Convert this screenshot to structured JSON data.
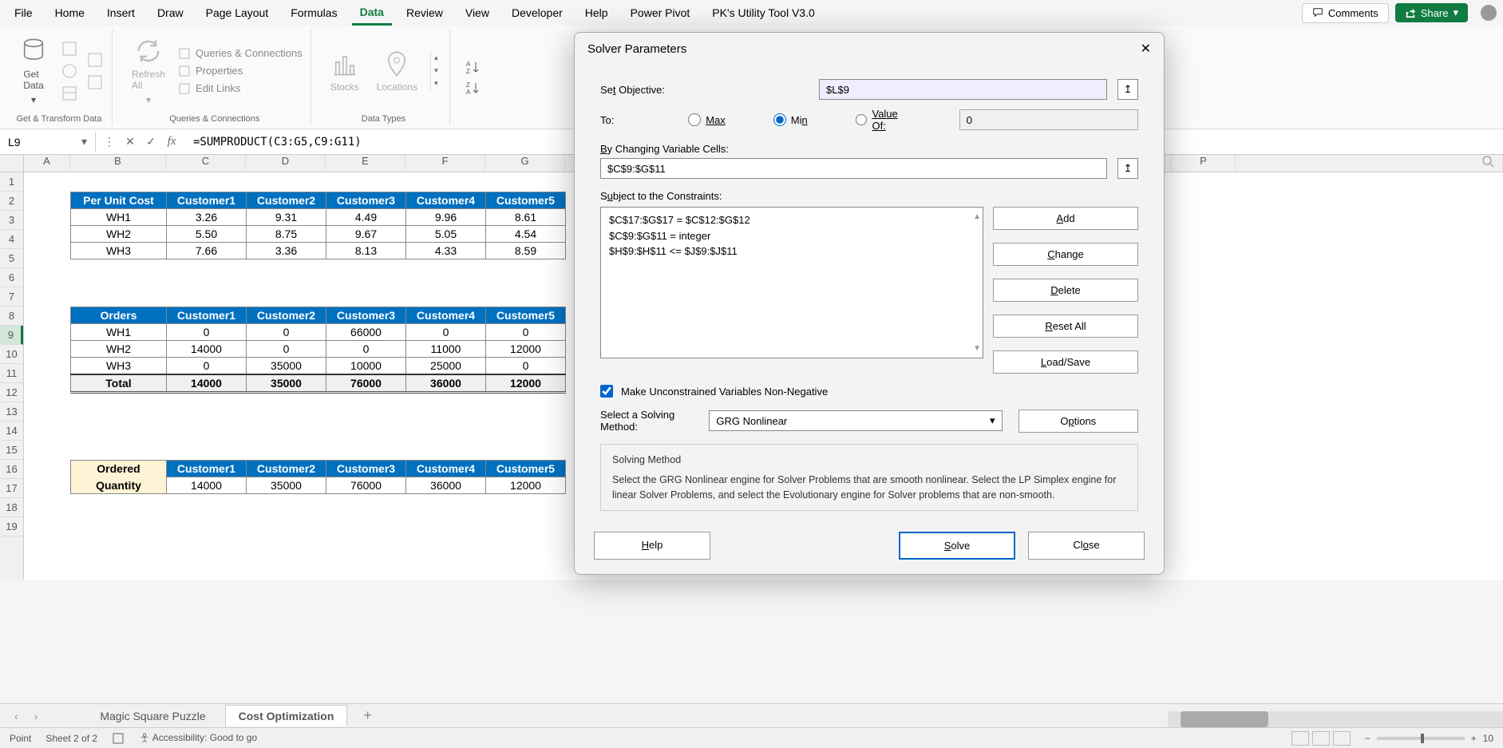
{
  "menu": {
    "items": [
      "File",
      "Home",
      "Insert",
      "Draw",
      "Page Layout",
      "Formulas",
      "Data",
      "Review",
      "View",
      "Developer",
      "Help",
      "Power Pivot",
      "PK's Utility Tool V3.0"
    ],
    "active": "Data",
    "comments": "Comments",
    "share": "Share"
  },
  "ribbon": {
    "group1": {
      "get_data": "Get\nData",
      "label": "Get & Transform Data"
    },
    "group2": {
      "refresh": "Refresh\nAll",
      "queries": "Queries & Connections",
      "properties": "Properties",
      "edit_links": "Edit Links",
      "label": "Queries & Connections"
    },
    "group3": {
      "stocks": "Stocks",
      "locations": "Locations",
      "label": "Data Types"
    }
  },
  "formula_bar": {
    "name": "L9",
    "formula": "=SUMPRODUCT(C3:G5,C9:G11)"
  },
  "columns": [
    "A",
    "B",
    "C",
    "D",
    "E",
    "F",
    "G",
    "P"
  ],
  "rows": [
    "1",
    "2",
    "3",
    "4",
    "5",
    "6",
    "7",
    "8",
    "9",
    "10",
    "11",
    "12",
    "13",
    "14",
    "15",
    "16",
    "17",
    "18",
    "19"
  ],
  "selected_row": "9",
  "tbl1": {
    "headers": [
      "Per Unit Cost",
      "Customer1",
      "Customer2",
      "Customer3",
      "Customer4",
      "Customer5"
    ],
    "rows": [
      [
        "WH1",
        "3.26",
        "9.31",
        "4.49",
        "9.96",
        "8.61"
      ],
      [
        "WH2",
        "5.50",
        "8.75",
        "9.67",
        "5.05",
        "4.54"
      ],
      [
        "WH3",
        "7.66",
        "3.36",
        "8.13",
        "4.33",
        "8.59"
      ]
    ]
  },
  "tbl2": {
    "headers": [
      "Orders",
      "Customer1",
      "Customer2",
      "Customer3",
      "Customer4",
      "Customer5"
    ],
    "rows": [
      [
        "WH1",
        "0",
        "0",
        "66000",
        "0",
        "0"
      ],
      [
        "WH2",
        "14000",
        "0",
        "0",
        "11000",
        "12000"
      ],
      [
        "WH3",
        "0",
        "35000",
        "10000",
        "25000",
        "0"
      ]
    ],
    "total": [
      "Total",
      "14000",
      "35000",
      "76000",
      "36000",
      "12000"
    ]
  },
  "tbl3": {
    "headers": [
      "Ordered",
      "Customer1",
      "Customer2",
      "Customer3",
      "Customer4",
      "Customer5"
    ],
    "row_label": "Quantity",
    "row": [
      "14000",
      "35000",
      "76000",
      "36000",
      "12000"
    ]
  },
  "dialog": {
    "title": "Solver Parameters",
    "set_objective_lbl": "Set Objective:",
    "set_objective_val": "$L$9",
    "to_lbl": "To:",
    "opt_max": "Max",
    "opt_min": "Min",
    "opt_value": "Value Of:",
    "value_of_val": "0",
    "by_changing_lbl": "By Changing Variable Cells:",
    "by_changing_val": "$C$9:$G$11",
    "subject_lbl": "Subject to the Constraints:",
    "constraints": [
      "$C$17:$G$17 = $C$12:$G$12",
      "$C$9:$G$11 = integer",
      "$H$9:$H$11 <= $J$9:$J$11"
    ],
    "btn_add": "Add",
    "btn_change": "Change",
    "btn_delete": "Delete",
    "btn_reset": "Reset All",
    "btn_loadsave": "Load/Save",
    "checkbox_lbl": "Make Unconstrained Variables Non-Negative",
    "method_lbl": "Select a Solving\nMethod:",
    "method_val": "GRG Nonlinear",
    "btn_options": "Options",
    "info_title": "Solving Method",
    "info_text": "Select the GRG Nonlinear engine for Solver Problems that are smooth nonlinear. Select the LP Simplex engine for linear Solver Problems, and select the Evolutionary engine for Solver problems that are non-smooth.",
    "btn_help": "Help",
    "btn_solve": "Solve",
    "btn_close": "Close"
  },
  "sheet_tabs": {
    "tab1": "Magic Square Puzzle",
    "tab2": "Cost Optimization"
  },
  "status": {
    "mode": "Point",
    "sheet": "Sheet 2 of 2",
    "access": "Accessibility: Good to go",
    "zoom": "10"
  }
}
